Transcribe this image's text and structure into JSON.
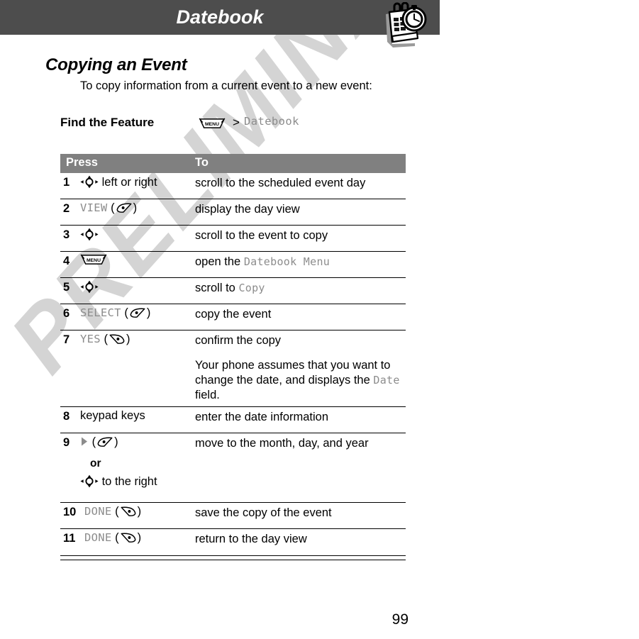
{
  "header": {
    "title": "Datebook",
    "icon": "datebook-calendar-clock-icon",
    "bar_color": "#4d4d4d"
  },
  "section": {
    "heading": "Copying an Event",
    "intro": "To copy information from a current event to a new event:"
  },
  "find_feature": {
    "label": "Find the Feature",
    "menu_key_label": "MENU",
    "separator": ">",
    "path": "Datebook"
  },
  "table": {
    "header_color": "#808080",
    "columns": [
      "Press",
      "To"
    ],
    "rows": [
      {
        "num": "1",
        "press_text": "left or right",
        "press_icon": "nav-key-icon",
        "to": "scroll to the scheduled event day"
      },
      {
        "num": "2",
        "press_label": "VIEW",
        "press_icon": "right-soft-key-icon",
        "to": "display the day view"
      },
      {
        "num": "3",
        "press_text": "",
        "press_icon": "nav-key-icon",
        "to": "scroll to the event to copy"
      },
      {
        "num": "4",
        "press_icon": "menu-key-icon",
        "to_prefix": "open the ",
        "to_mono": "Datebook Menu"
      },
      {
        "num": "5",
        "press_text": "",
        "press_icon": "nav-key-icon",
        "to_prefix": "scroll to ",
        "to_mono": "Copy"
      },
      {
        "num": "6",
        "press_label": "SELECT",
        "press_icon": "right-soft-key-icon",
        "to": "copy the event"
      },
      {
        "num": "7",
        "press_label": "YES",
        "press_icon": "left-soft-key-icon",
        "to": "confirm the copy",
        "note_part1": "Your phone assumes that you want to change the date, and displays the ",
        "note_mono": "Date",
        "note_part2": " field."
      },
      {
        "num": "8",
        "press_text": "keypad keys",
        "to": "enter the date information"
      },
      {
        "num": "9",
        "press_icon": "triangle-right-icon",
        "press_icon2": "right-soft-key-icon",
        "or_label": "or",
        "alt_icon": "nav-key-icon",
        "alt_text": "to the right",
        "to": "move to the month, day, and year"
      },
      {
        "num": "10",
        "press_label": "DONE",
        "press_icon": "left-soft-key-icon",
        "to": "save the copy of the event"
      },
      {
        "num": "11",
        "press_label": "DONE",
        "press_icon": "left-soft-key-icon",
        "to": "return to the day view"
      }
    ]
  },
  "watermark": {
    "text": "PRELIMINARY",
    "color": "#d4d4d4"
  },
  "footer": {
    "page_number": "99"
  }
}
